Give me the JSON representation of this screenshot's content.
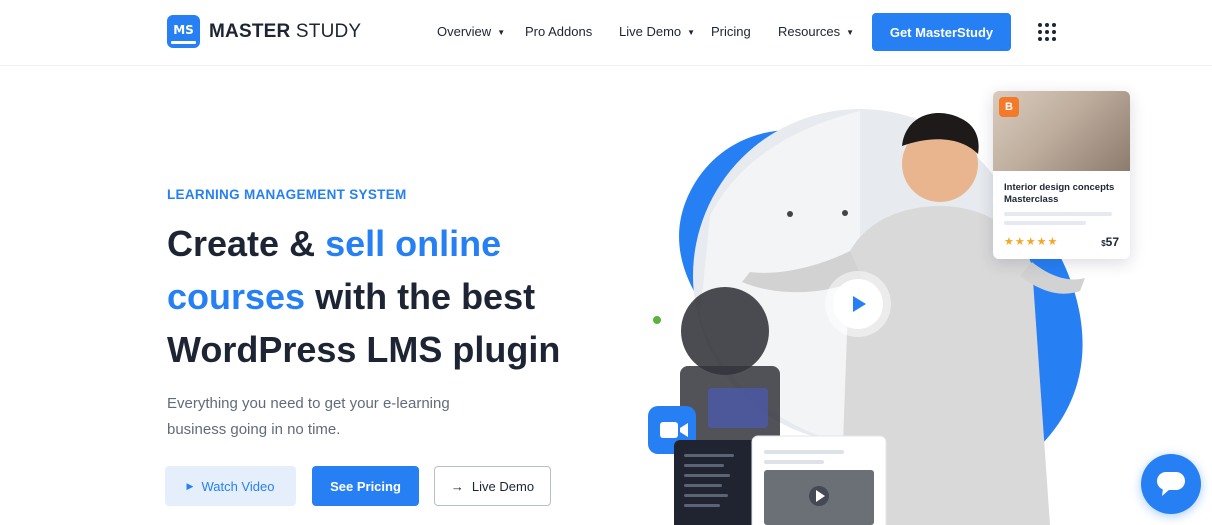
{
  "brand": {
    "mark": "MS",
    "name_bold": "MASTER",
    "name_light": "STUDY"
  },
  "nav": {
    "items": [
      {
        "label": "Overview",
        "dropdown": true
      },
      {
        "label": "Pro Addons",
        "dropdown": false
      },
      {
        "label": "Live Demo",
        "dropdown": true
      },
      {
        "label": "Pricing",
        "dropdown": false
      },
      {
        "label": "Resources",
        "dropdown": true
      }
    ],
    "cta_label": "Get MasterStudy",
    "apps_icon": "grid-dots-icon"
  },
  "hero": {
    "eyebrow": "LEARNING MANAGEMENT SYSTEM",
    "headline": {
      "part1": "Create & ",
      "part2_blue": "sell online",
      "part3_blue": "courses",
      "part4": " with the best",
      "part5": "WordPress LMS plugin"
    },
    "subtitle": "Everything you need to get your e-learning business going in no time.",
    "buttons": {
      "watch_video": "Watch Video",
      "see_pricing": "See Pricing",
      "live_demo": "Live Demo"
    }
  },
  "course_card": {
    "title": "Interior design concepts Masterclass",
    "rating": "★★★★★",
    "price_currency": "$",
    "price_value": "57"
  },
  "colors": {
    "accent": "#2680f4",
    "text_dark": "#1d2433",
    "text_muted": "#626b7a",
    "star": "#f5a623"
  }
}
